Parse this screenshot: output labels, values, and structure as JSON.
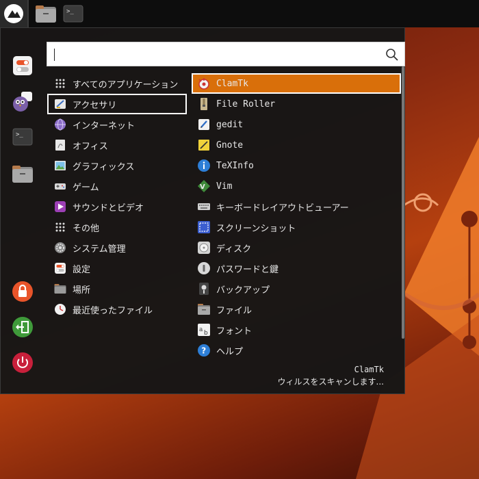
{
  "search": {
    "value": ""
  },
  "categories": [
    {
      "label": "すべてのアプリケーション",
      "icon": "grid-icon"
    },
    {
      "label": "アクセサリ",
      "icon": "accessories-icon",
      "selected": true
    },
    {
      "label": "インターネット",
      "icon": "internet-icon"
    },
    {
      "label": "オフィス",
      "icon": "office-icon"
    },
    {
      "label": "グラフィックス",
      "icon": "graphics-icon"
    },
    {
      "label": "ゲーム",
      "icon": "gamepad-icon"
    },
    {
      "label": "サウンドとビデオ",
      "icon": "multimedia-icon"
    },
    {
      "label": "その他",
      "icon": "grid-icon"
    },
    {
      "label": "システム管理",
      "icon": "system-gear-icon"
    },
    {
      "label": "設定",
      "icon": "settings-toggle-icon"
    },
    {
      "label": "場所",
      "icon": "folder-icon"
    },
    {
      "label": "最近使ったファイル",
      "icon": "clock-icon"
    }
  ],
  "apps": [
    {
      "label": "ClamTk",
      "icon": "clamtk-icon",
      "mono": true,
      "active": true
    },
    {
      "label": "File Roller",
      "icon": "file-roller-icon",
      "mono": true
    },
    {
      "label": "gedit",
      "icon": "gedit-icon",
      "mono": true
    },
    {
      "label": "Gnote",
      "icon": "gnote-icon",
      "mono": true
    },
    {
      "label": "TeXInfo",
      "icon": "info-icon",
      "mono": true
    },
    {
      "label": "Vim",
      "icon": "vim-icon",
      "mono": true
    },
    {
      "label": "キーボードレイアウトビューアー",
      "icon": "keyboard-icon"
    },
    {
      "label": "スクリーンショット",
      "icon": "screenshot-icon"
    },
    {
      "label": "ディスク",
      "icon": "disk-icon"
    },
    {
      "label": "パスワードと鍵",
      "icon": "password-keys-icon"
    },
    {
      "label": "バックアップ",
      "icon": "backup-icon"
    },
    {
      "label": "ファイル",
      "icon": "files-icon"
    },
    {
      "label": "フォント",
      "icon": "font-icon"
    },
    {
      "label": "ヘルプ",
      "icon": "help-icon"
    }
  ],
  "description": {
    "name": "ClamTk",
    "text": "ウィルスをスキャンします..."
  },
  "colors": {
    "active_highlight": "#d96f0a",
    "panel_bg": "#0d0d0d",
    "menu_bg": "#161616"
  }
}
